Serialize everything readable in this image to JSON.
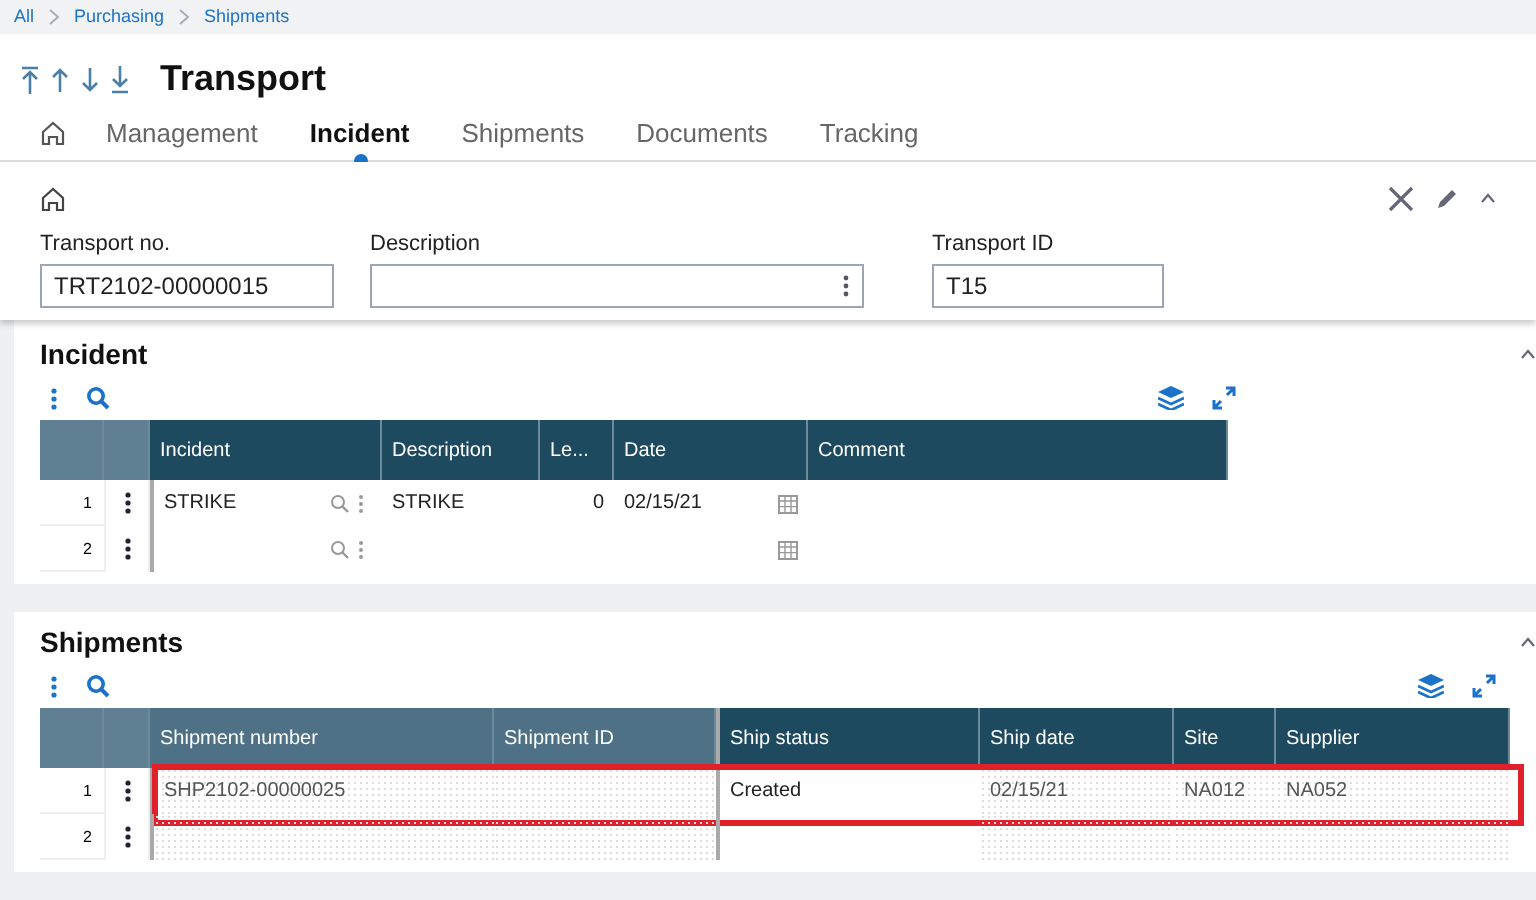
{
  "breadcrumb": [
    "All",
    "Purchasing",
    "Shipments"
  ],
  "title": "Transport",
  "tabs": [
    {
      "label": "Management",
      "selected": false
    },
    {
      "label": "Incident",
      "selected": true
    },
    {
      "label": "Shipments",
      "selected": false
    },
    {
      "label": "Documents",
      "selected": false
    },
    {
      "label": "Tracking",
      "selected": false
    }
  ],
  "header_form": {
    "fields": [
      {
        "label": "Transport no.",
        "value": "TRT2102-00000015",
        "kind": "text"
      },
      {
        "label": "Description",
        "kind": "menu"
      },
      {
        "label": "Transport ID",
        "value": "T15",
        "kind": "text"
      }
    ]
  },
  "incident_section": {
    "title": "Incident",
    "table": {
      "columns": [
        {
          "label": "Incident",
          "kind": "lookup"
        },
        {
          "label": "Description",
          "kind": "text"
        },
        {
          "label": "Le...",
          "kind": "number"
        },
        {
          "label": "Date",
          "kind": "date"
        },
        {
          "label": "Comment",
          "kind": "text"
        }
      ],
      "rows": [
        {
          "number": "1",
          "incident": "STRIKE",
          "description": "STRIKE",
          "level": "0",
          "date": "02/15/21"
        },
        {
          "number": "2"
        }
      ]
    }
  },
  "shipments_section": {
    "title": "Shipments",
    "table": {
      "columns": [
        {
          "label": "Shipment number",
          "frozen": true,
          "readonly": true
        },
        {
          "label": "Shipment ID",
          "frozen": true,
          "readonly": true
        },
        {
          "label": "Ship status",
          "frozen": false,
          "readonly": false
        },
        {
          "label": "Ship date",
          "frozen": false,
          "readonly": true
        },
        {
          "label": "Site",
          "frozen": false,
          "readonly": true
        },
        {
          "label": "Supplier",
          "frozen": false,
          "readonly": true
        }
      ],
      "rows": [
        {
          "number": "1",
          "highlighted": true,
          "shipment_number": "SHP2102-00000025",
          "ship_status": "Created",
          "ship_date": "02/15/21",
          "site": "NA012",
          "supplier": "NA052"
        },
        {
          "number": "2",
          "highlighted": false
        }
      ]
    }
  }
}
